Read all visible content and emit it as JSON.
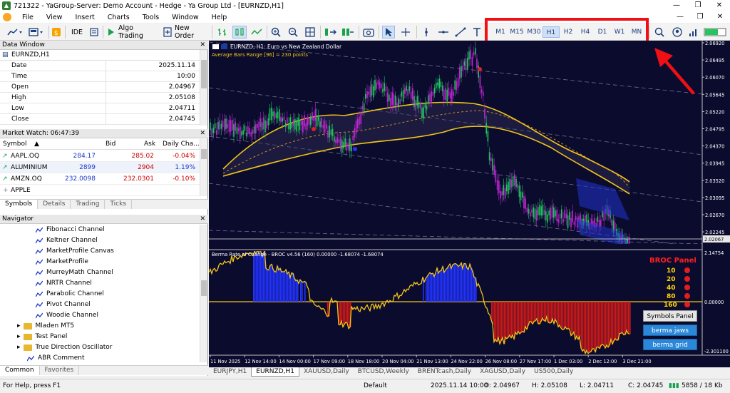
{
  "window": {
    "title": "721322 - YaGroup-Server: Demo Account - Hedge - Ya Group Ltd - [EURNZD,H1]",
    "min": "—",
    "max": "❐",
    "close": "✕"
  },
  "menu": [
    "File",
    "View",
    "Insert",
    "Charts",
    "Tools",
    "Window",
    "Help"
  ],
  "mdi_controls": [
    "—",
    "❐",
    "✕"
  ],
  "toolbar": {
    "ide": "IDE",
    "algo": "Algo Trading",
    "neworder": "New Order"
  },
  "timeframes": [
    "M1",
    "M15",
    "M30",
    "H1",
    "H2",
    "H4",
    "D1",
    "W1",
    "MN"
  ],
  "active_timeframe": "H1",
  "data_window": {
    "title": "Data Window",
    "symbol": "EURNZD,H1",
    "rows": [
      {
        "k": "Date",
        "v": "2025.11.14"
      },
      {
        "k": "Time",
        "v": "10:00"
      },
      {
        "k": "Open",
        "v": "2.04967"
      },
      {
        "k": "High",
        "v": "2.05108"
      },
      {
        "k": "Low",
        "v": "2.04711"
      },
      {
        "k": "Close",
        "v": "2.04745"
      }
    ]
  },
  "market_watch": {
    "title": "Market Watch: 06:47:39",
    "headers": [
      "Symbol",
      "Bid",
      "Ask",
      "Daily Cha..."
    ],
    "rows": [
      {
        "s": "AAPL.OQ",
        "b": "284.17",
        "a": "285.02",
        "c": "-0.04%",
        "cc": "#d00000"
      },
      {
        "s": "ALUMINIUM",
        "b": "2899",
        "a": "2904",
        "c": "1.19%",
        "cc": "#1b39c9"
      },
      {
        "s": "AMZN.OQ",
        "b": "232.0098",
        "a": "232.0301",
        "c": "-0.10%",
        "cc": "#d00000"
      },
      {
        "s": "APPLE",
        "b": "",
        "a": "",
        "c": "",
        "cc": "#000"
      }
    ],
    "tabs": [
      "Symbols",
      "Details",
      "Trading",
      "Ticks"
    ]
  },
  "navigator": {
    "title": "Navigator",
    "items": [
      "Fibonacci Channel",
      "Keltner Channel",
      "MarketProfile Canvas",
      "MarketProfile",
      "MurreyMath Channel",
      "NRTR Channel",
      "Parabolic Channel",
      "Pivot Channel",
      "Woodie Channel"
    ],
    "folders": [
      "Mladen MT5",
      "Test Panel",
      "True Direction Oscillator"
    ],
    "last": "ABR Comment",
    "tabs": [
      "Common",
      "Favorites"
    ]
  },
  "chart": {
    "header": "EURNZD, H1:  Euro vs New Zealand Dollar",
    "abr": "Average Bars Range [96] = 230 points",
    "price_labels": [
      "2.06920",
      "2.06495",
      "2.06070",
      "2.05645",
      "2.05220",
      "2.04795",
      "2.04370",
      "2.03945",
      "2.03520",
      "2.03095",
      "2.02670",
      "2.02245",
      "2.02067"
    ],
    "broc_header": "Berma Rate of Change - BROC v4.56 (160) 0.00000 -1.68074 -1.68074",
    "broc_levels": [
      "2.14754",
      "0.00000",
      "-2.301100"
    ],
    "time_labels": [
      "11 Nov 2025",
      "12 Nov 14:00",
      "14 Nov 00:00",
      "17 Nov 09:00",
      "18 Nov 18:00",
      "20 Nov 04:00",
      "21 Nov 13:00",
      "24 Nov 22:00",
      "26 Nov 08:00",
      "27 Nov 17:00",
      "1 Dec 03:00",
      "2 Dec 12:00",
      "3 Dec 21:00"
    ]
  },
  "broc_panel": {
    "title": "BROC Panel",
    "periods": [
      "10",
      "20",
      "40",
      "80",
      "160"
    ],
    "buttons": [
      "Symbols Panel",
      "berma jaws",
      "berma grid"
    ]
  },
  "chart_tabs": [
    "EURJPY,H1",
    "EURNZD,H1",
    "XAUUSD,Daily",
    "BTCUSD,Weekly",
    "BRENTcash,Daily",
    "XAGUSD,Daily",
    "US500,Daily"
  ],
  "active_chart_tab": "EURNZD,H1",
  "status": {
    "help": "For Help, press F1",
    "profile": "Default",
    "datetime": "2025.11.14 10:00",
    "open": "O: 2.04967",
    "high": "H: 2.05108",
    "low": "L: 2.04711",
    "close": "C: 2.04745",
    "traffic": "5858 / 18 Kb"
  }
}
